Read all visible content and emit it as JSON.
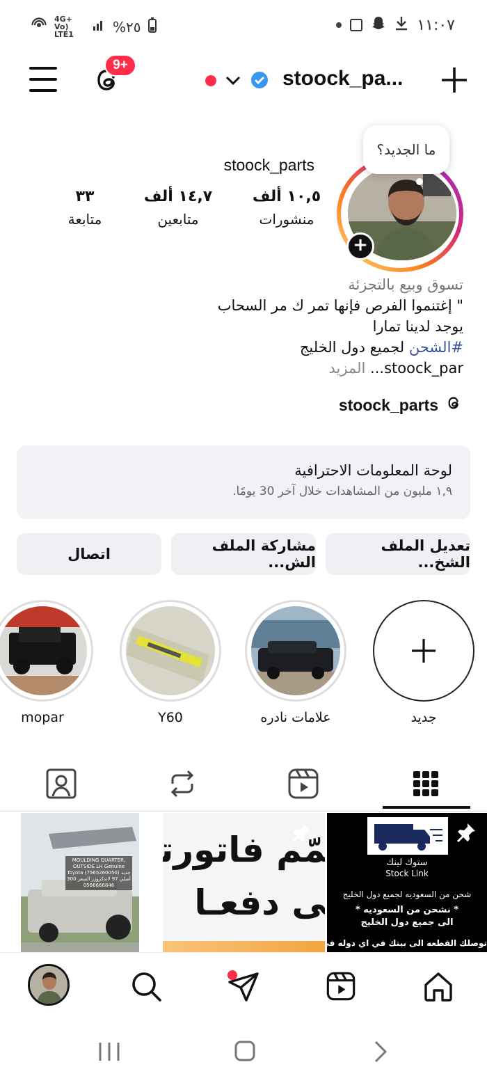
{
  "status_bar": {
    "time": "١١:٠٧",
    "battery": "%٢٥",
    "network": "4G+ Vo) LTE1"
  },
  "header": {
    "username": "stoock_pa...",
    "notification_badge": "9+"
  },
  "profile": {
    "display_name": "stoock_parts",
    "note_bubble": "ما الجديد؟",
    "stats": [
      {
        "value": "١٠,٥ ألف",
        "label": "منشورات"
      },
      {
        "value": "١٤,٧ ألف",
        "label": "متابعين"
      },
      {
        "value": "٣٣",
        "label": "متابعة"
      }
    ],
    "bio": {
      "category": "تسوق وبيع بالتجزئة",
      "line1": "\" إغتنموا الفرص فإنها تمر ك مر السحاب",
      "line2": "يوجد لدينا تمارا",
      "hashtag": "#الشحن",
      "line3_rest": " لجميع دول الخليج",
      "line4": "stoock_par...",
      "more": "المزيد"
    },
    "threads_handle": "stoock_parts"
  },
  "dashboard": {
    "title": "لوحة المعلومات الاحترافية",
    "subtitle": "١,٩ مليون من المشاهدات خلال آخر 30 يومًا."
  },
  "buttons": {
    "edit": "تعديل الملف الشخ...",
    "share": "مشاركة الملف الش...",
    "contact": "اتصال"
  },
  "highlights": [
    {
      "label": "جديد"
    },
    {
      "label": "علامات نادره"
    },
    {
      "label": "Y60"
    },
    {
      "label": "mopar"
    }
  ],
  "posts": {
    "post1": {
      "brand_ar": "ستوك لينك",
      "brand_en": "Stock Link",
      "line1": "شحن من السعوديه لجميع دول الخليج",
      "line2": "* نشحن من السعوديه *",
      "line3": "الى جميع دول الخليج",
      "line4": "توصلك القطعه الى بيتك في اي دوله في"
    },
    "post2": {
      "line1": "ـمّم فاتورتـ",
      "line2": "ـى دفعـا"
    },
    "post3": {
      "caption": "MOULDING QUARTER, OUTSIDE LH Genuine Toyota (7565260050) جديد أصلي 97 لاندكروزر السعر 300 0566666846"
    }
  },
  "colors": {
    "accent_red": "#ff2d4a",
    "verified_blue": "#3897f0",
    "link_blue": "#3a4fa0"
  }
}
